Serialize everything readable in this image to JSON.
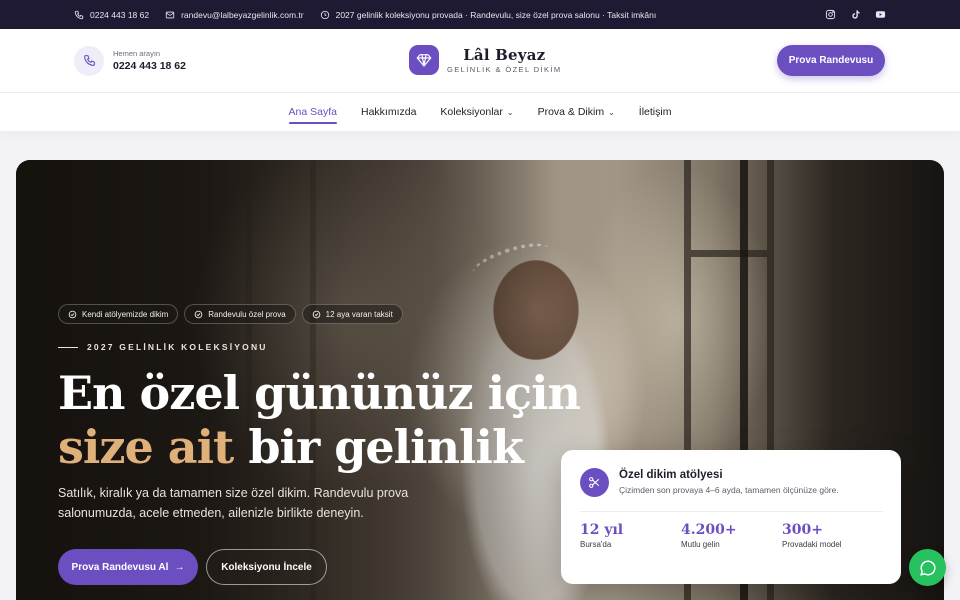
{
  "topbar": {
    "phone": "0224 443 18 62",
    "email": "randevu@lalbeyazgelinlik.com.tr",
    "announcement": "2027 gelinlik koleksiyonu provada · Randevulu, size özel prova salonu · Taksit imkânı",
    "social": [
      "instagram-icon",
      "tiktok-icon",
      "youtube-icon"
    ]
  },
  "header": {
    "call_label": "Hemen arayın",
    "call_number": "0224 443 18 62",
    "brand_name": "Lâl Beyaz",
    "brand_sub": "GELİNLİK & ÖZEL DİKİM",
    "cta": "Prova Randevusu"
  },
  "nav": {
    "items": [
      {
        "label": "Ana Sayfa",
        "active": true
      },
      {
        "label": "Hakkımızda"
      },
      {
        "label": "Koleksiyonlar",
        "dropdown": true
      },
      {
        "label": "Prova & Dikim",
        "dropdown": true
      },
      {
        "label": "İletişim"
      }
    ]
  },
  "hero": {
    "badges": [
      "Kendi atölyemizde dikim",
      "Randevulu özel prova",
      "12 aya varan taksit"
    ],
    "eyebrow": "2027 GELİNLİK KOLEKSİYONU",
    "headline_line1": "En özel gününüz için",
    "headline_gold": "size ait",
    "headline_rest": "bir gelinlik",
    "lead": "Satılık, kiralık ya da tamamen size özel dikim. Randevulu prova salonumuzda, acele etmeden, ailenizle birlikte deneyin.",
    "primary_button": "Prova Randevusu Al",
    "secondary_button": "Koleksiyonu İncele"
  },
  "card": {
    "title": "Özel dikim atölyesi",
    "description": "Çizimden son provaya 4–6 ayda, tamamen ölçünüze göre.",
    "stats": [
      {
        "value": "12 yıl",
        "label": "Bursa'da"
      },
      {
        "value": "4.200+",
        "label": "Mutlu gelin"
      },
      {
        "value": "300+",
        "label": "Provadaki model"
      }
    ]
  },
  "colors": {
    "accent": "#6b4fc1",
    "topbar": "#1e1a33",
    "gold": "#e0b07a",
    "chat": "#27c25f"
  }
}
